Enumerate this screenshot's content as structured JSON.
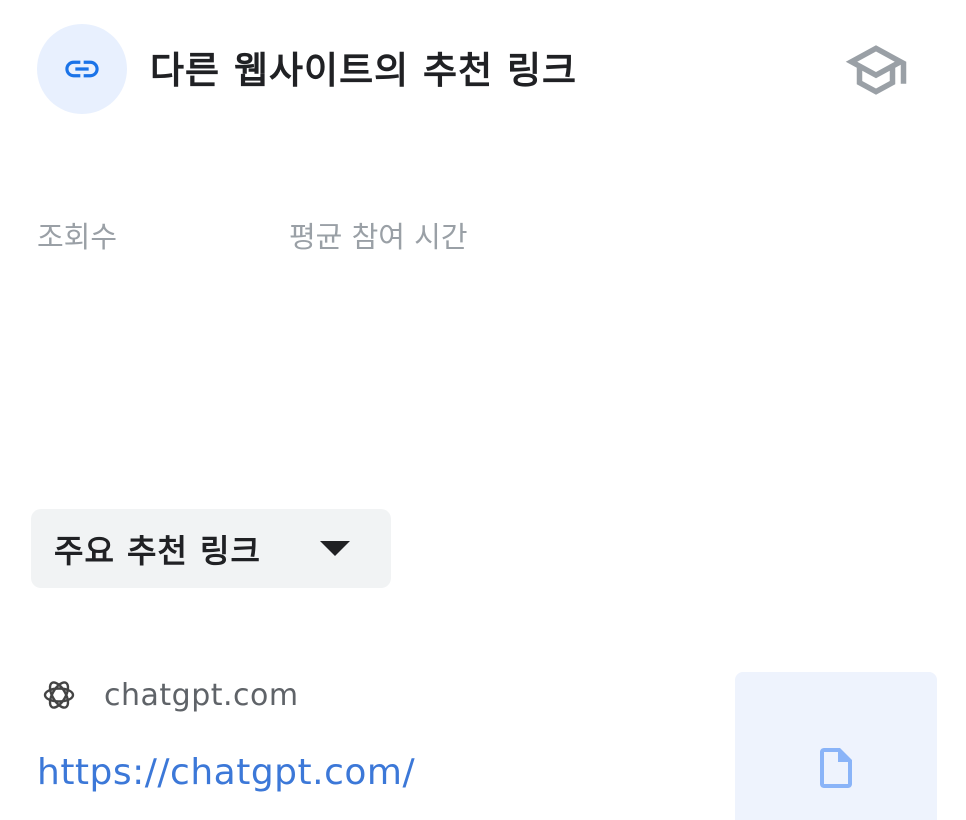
{
  "header": {
    "title": "다른 웹사이트의 추천 링크",
    "link_icon": "link-icon",
    "school_icon": "school-icon",
    "link_icon_bg": "#e8f0fe",
    "link_icon_color": "#1a73e8"
  },
  "stats": {
    "views_label": "조회수",
    "avg_engagement_label": "평균 참여 시간"
  },
  "dropdown": {
    "selected": "주요 추천 링크",
    "icon": "arrow-drop-down-icon"
  },
  "referrer": {
    "logo": "chatgpt-logo-icon",
    "domain": "chatgpt.com",
    "url": "https://chatgpt.com/",
    "thumbnail_icon": "document-icon",
    "url_color": "#3c78d8"
  }
}
